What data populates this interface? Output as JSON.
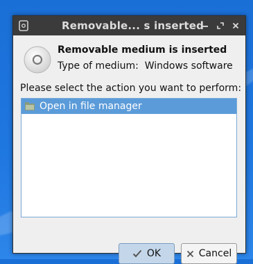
{
  "window": {
    "title": "Removable... s inserted"
  },
  "dialog": {
    "heading": "Removable medium is inserted",
    "medium_type": "Type of medium:  Windows software",
    "prompt": "Please select the action you want to perform:",
    "actions": [
      {
        "label": "Open in file manager",
        "icon": "folder-icon",
        "selected": true
      }
    ]
  },
  "buttons": {
    "ok_label": "OK",
    "cancel_label": "Cancel"
  },
  "colors": {
    "titlebar": "#3b3b3b",
    "selection": "#5b9bd9",
    "desktop": "#1f77e0",
    "ok_button": "#c4d7ea"
  }
}
